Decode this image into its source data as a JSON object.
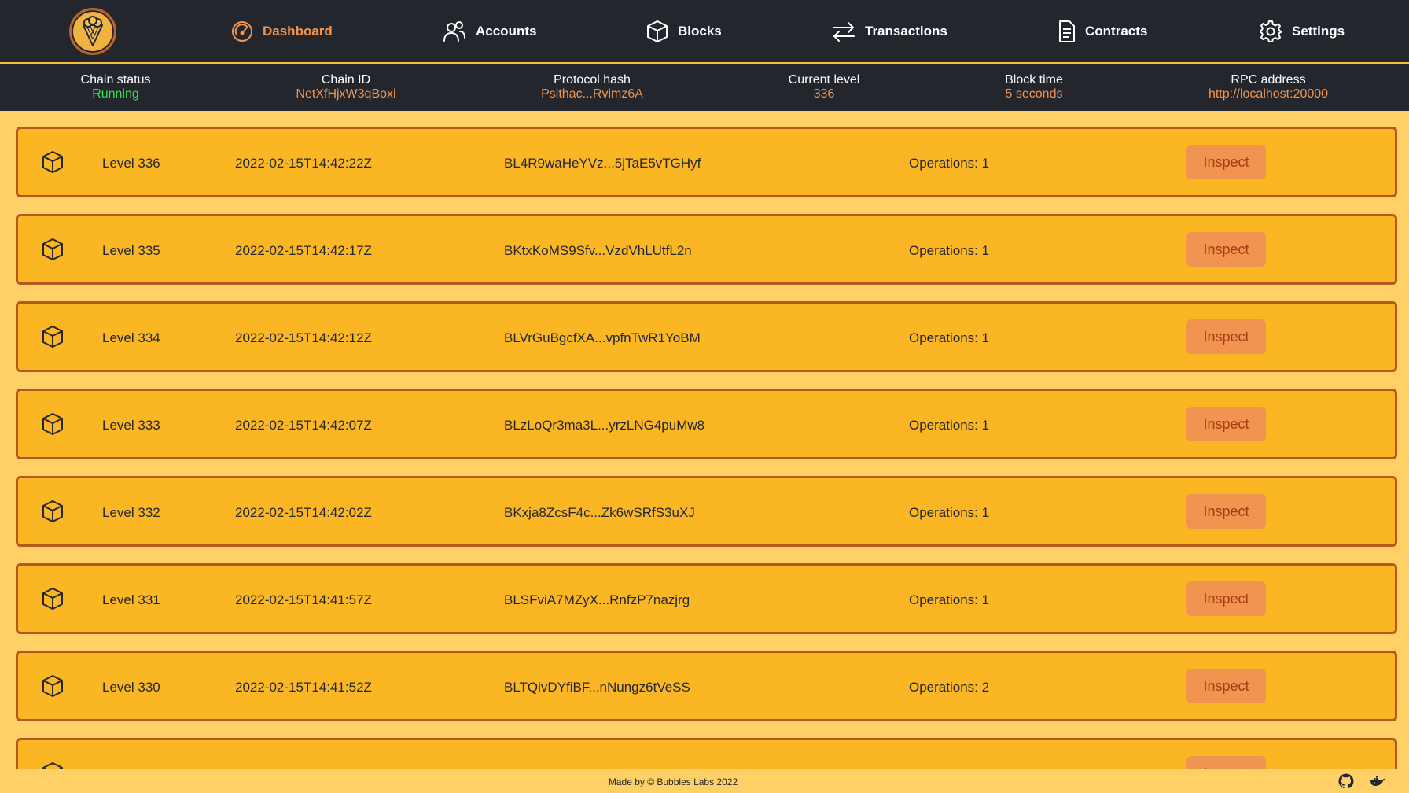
{
  "nav": {
    "items": [
      {
        "label": "Dashboard",
        "icon": "gauge-icon"
      },
      {
        "label": "Accounts",
        "icon": "users-icon"
      },
      {
        "label": "Blocks",
        "icon": "cube-icon"
      },
      {
        "label": "Transactions",
        "icon": "arrows-icon"
      },
      {
        "label": "Contracts",
        "icon": "document-icon"
      },
      {
        "label": "Settings",
        "icon": "gear-icon"
      }
    ],
    "active": "Dashboard"
  },
  "status": {
    "chain_status": {
      "label": "Chain status",
      "value": "Running"
    },
    "chain_id": {
      "label": "Chain ID",
      "value": "NetXfHjxW3qBoxi"
    },
    "protocol_hash": {
      "label": "Protocol hash",
      "value": "Psithac...Rvimz6A"
    },
    "current_level": {
      "label": "Current level",
      "value": "336"
    },
    "block_time": {
      "label": "Block time",
      "value": "5 seconds"
    },
    "rpc_address": {
      "label": "RPC address",
      "value": "http://localhost:20000"
    }
  },
  "blocks": [
    {
      "level": "Level 336",
      "timestamp": "2022-02-15T14:42:22Z",
      "hash": "BL4R9waHeYVz...5jTaE5vTGHyf",
      "operations": "Operations: 1",
      "action": "Inspect"
    },
    {
      "level": "Level 335",
      "timestamp": "2022-02-15T14:42:17Z",
      "hash": "BKtxKoMS9Sfv...VzdVhLUtfL2n",
      "operations": "Operations: 1",
      "action": "Inspect"
    },
    {
      "level": "Level 334",
      "timestamp": "2022-02-15T14:42:12Z",
      "hash": "BLVrGuBgcfXA...vpfnTwR1YoBM",
      "operations": "Operations: 1",
      "action": "Inspect"
    },
    {
      "level": "Level 333",
      "timestamp": "2022-02-15T14:42:07Z",
      "hash": "BLzLoQr3ma3L...yrzLNG4puMw8",
      "operations": "Operations: 1",
      "action": "Inspect"
    },
    {
      "level": "Level 332",
      "timestamp": "2022-02-15T14:42:02Z",
      "hash": "BKxja8ZcsF4c...Zk6wSRfS3uXJ",
      "operations": "Operations: 1",
      "action": "Inspect"
    },
    {
      "level": "Level 331",
      "timestamp": "2022-02-15T14:41:57Z",
      "hash": "BLSFviA7MZyX...RnfzP7nazjrg",
      "operations": "Operations: 1",
      "action": "Inspect"
    },
    {
      "level": "Level 330",
      "timestamp": "2022-02-15T14:41:52Z",
      "hash": "BLTQivDYfiBF...nNungz6tVeSS",
      "operations": "Operations: 2",
      "action": "Inspect"
    },
    {
      "level": "",
      "timestamp": "",
      "hash": "",
      "operations": "",
      "action": "Inspect"
    }
  ],
  "footer": {
    "credit": "Made by © Bubbles Labs 2022",
    "links": [
      "github-icon",
      "docker-icon"
    ]
  },
  "colors": {
    "nav_bg": "#23272d",
    "accent": "#f0944f",
    "running": "#36e04a",
    "row_bg": "#fbb623",
    "row_border": "#b5581f",
    "page_bg": "#fed065"
  }
}
